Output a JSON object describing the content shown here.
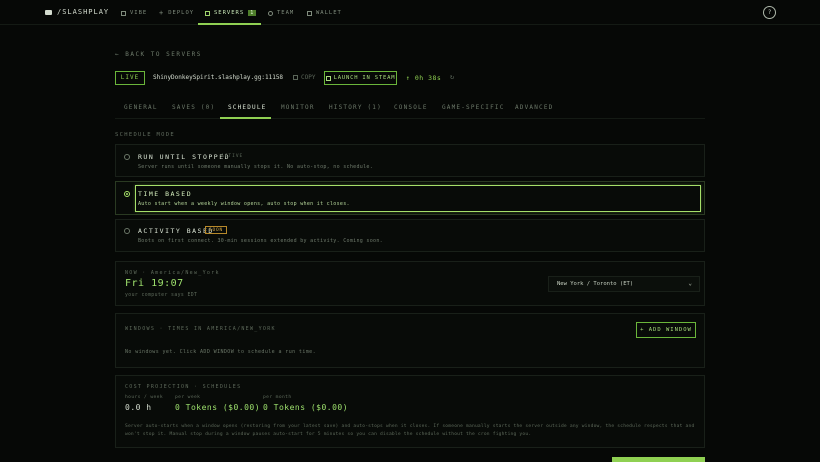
{
  "brand": {
    "name": "/SLASHPLAY"
  },
  "nav": {
    "items": [
      {
        "label": "VIBE",
        "icon": "grid-icon"
      },
      {
        "label": "DEPLOY",
        "icon": "plus-icon"
      },
      {
        "label": "SERVERS",
        "icon": "wrench-icon",
        "badge": "1",
        "active": true
      },
      {
        "label": "TEAM",
        "icon": "users-icon"
      },
      {
        "label": "WALLET",
        "icon": "wallet-icon"
      }
    ],
    "profile_icon": "user-circle-icon",
    "profile_initial": "?"
  },
  "back": {
    "label": "← BACK TO SERVERS"
  },
  "server": {
    "status": "LIVE",
    "host": "ShinyDonkeySpirit.slashplay.gg:11158",
    "copy_label": "COPY",
    "launch_label": "LAUNCH IN STEAM",
    "uptime": "↑ 0h 38s",
    "refresh_icon": "↻"
  },
  "tabs": [
    {
      "label": "GENERAL"
    },
    {
      "label": "SAVES (0)"
    },
    {
      "label": "SCHEDULE",
      "active": true
    },
    {
      "label": "MONITOR"
    },
    {
      "label": "HISTORY (1)"
    },
    {
      "label": "CONSOLE"
    },
    {
      "label": "GAME-SPECIFIC"
    },
    {
      "label": "ADVANCED"
    }
  ],
  "schedule_mode": {
    "label": "SCHEDULE MODE",
    "options": [
      {
        "title": "RUN UNTIL STOPPED",
        "tag": "ACTIVE",
        "desc": "Server runs until someone manually stops it. No auto-stop, no schedule."
      },
      {
        "title": "TIME BASED",
        "desc": "Auto start when a weekly window opens, auto stop when it closes.",
        "selected": true
      },
      {
        "title": "ACTIVITY BASED",
        "tag": "SOON",
        "desc": "Boots on first connect. 30-min sessions extended by activity. Coming soon."
      }
    ]
  },
  "now": {
    "label": "NOW · America/New_York",
    "time": "Fri 19:07",
    "sub": "your computer says EDT",
    "timezone": "New York / Toronto (ET)"
  },
  "windows": {
    "label": "WINDOWS · TIMES IN AMERICA/NEW_YORK",
    "add_label": "+ ADD WINDOW",
    "empty_text": "No windows yet. Click ADD WINDOW to schedule a run time."
  },
  "cost": {
    "label": "COST PROJECTION · SCHEDULES",
    "cols": [
      {
        "header": "hours / week",
        "value": "0.0 h"
      },
      {
        "header": "per week",
        "value": "0 Tokens ($0.00)"
      },
      {
        "header": "per month",
        "value": "0 Tokens ($0.00)"
      }
    ],
    "note": "Server auto-starts when a window opens (restoring from your latest save) and auto-stops when it closes. If someone manually starts the server outside any window, the schedule respects that and won't stop it. Manual stop during a window pauses auto-start for 5 minutes so you can disable the schedule without the cron fighting you."
  },
  "colors": {
    "accent": "#8fd052",
    "background": "#060806",
    "soon": "#d1a649"
  }
}
